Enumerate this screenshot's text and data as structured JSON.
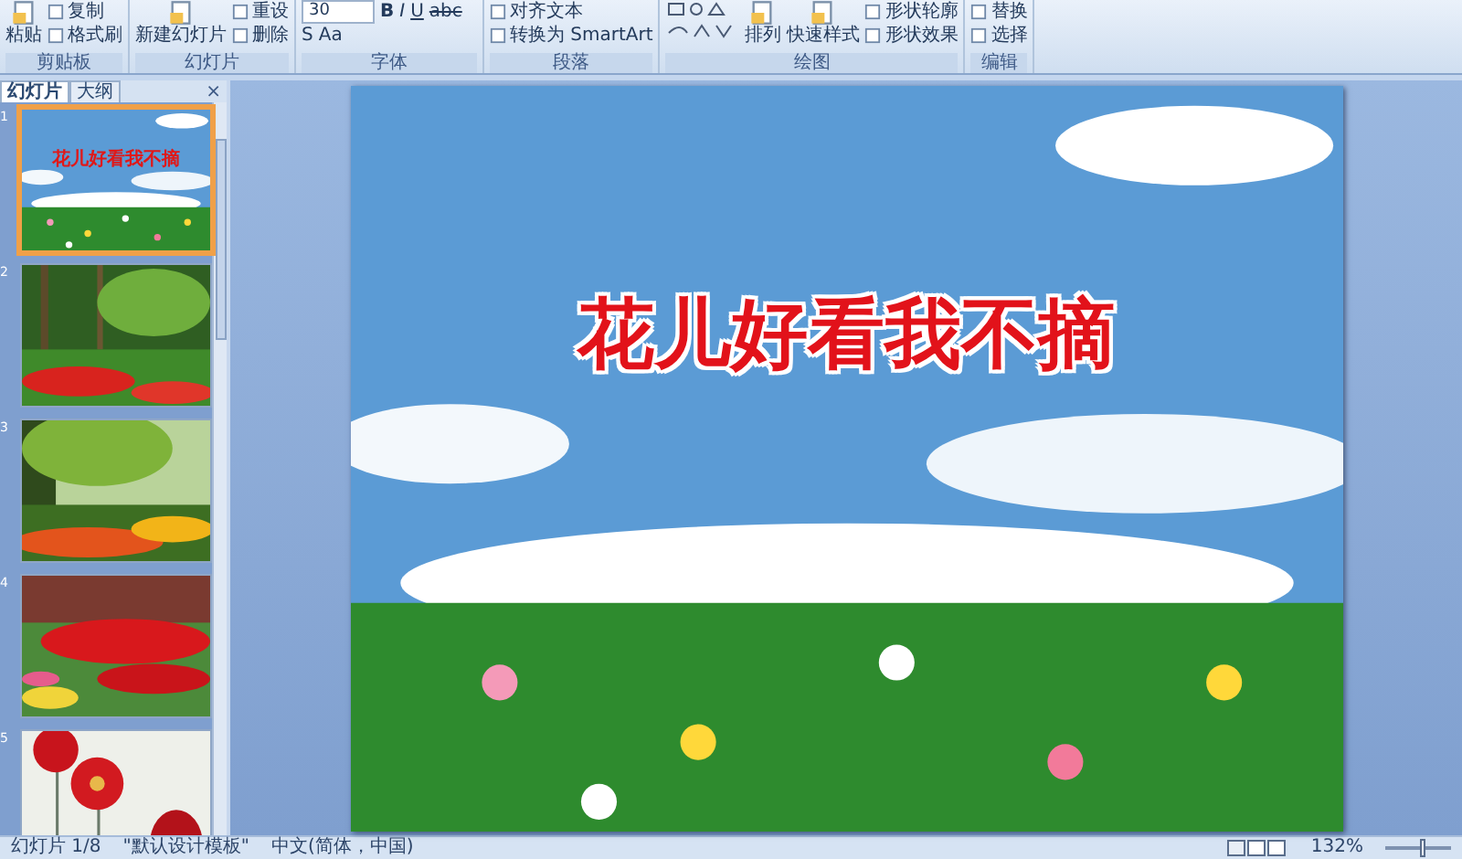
{
  "ribbon": {
    "groups": [
      {
        "label": "剪贴板",
        "items": [
          {
            "kind": "big",
            "label": "粘贴"
          },
          {
            "kind": "small",
            "label": "复制"
          },
          {
            "kind": "small",
            "label": "格式刷"
          }
        ]
      },
      {
        "label": "幻灯片",
        "items": [
          {
            "kind": "big",
            "label": "新建幻灯片"
          },
          {
            "kind": "small",
            "label": "重设"
          },
          {
            "kind": "small",
            "label": "删除"
          }
        ]
      },
      {
        "label": "字体",
        "items": [
          {
            "kind": "field",
            "label": "30"
          },
          {
            "kind": "bold",
            "label": "B"
          },
          {
            "kind": "italic",
            "label": "I"
          },
          {
            "kind": "underline",
            "label": "U"
          },
          {
            "kind": "strike",
            "label": "abc"
          },
          {
            "kind": "plain",
            "label": "S"
          },
          {
            "kind": "plain",
            "label": "Aa"
          }
        ]
      },
      {
        "label": "段落",
        "items": [
          {
            "kind": "small",
            "label": "对齐文本"
          },
          {
            "kind": "small",
            "label": "转换为 SmartArt"
          }
        ]
      },
      {
        "label": "绘图",
        "items": [
          {
            "kind": "shapes"
          },
          {
            "kind": "big",
            "label": "排列"
          },
          {
            "kind": "big",
            "label": "快速样式"
          },
          {
            "kind": "small",
            "label": "形状轮廓"
          },
          {
            "kind": "small",
            "label": "形状效果"
          }
        ]
      },
      {
        "label": "编辑",
        "items": [
          {
            "kind": "small",
            "label": "替换"
          },
          {
            "kind": "small",
            "label": "选择"
          }
        ]
      }
    ]
  },
  "panel": {
    "tabs": [
      {
        "label": "幻灯片",
        "selected": true
      },
      {
        "label": "大纲",
        "selected": false
      }
    ],
    "close": "×"
  },
  "slides": [
    {
      "number": "1",
      "selected": true,
      "title": "花儿好看我不摘"
    },
    {
      "number": "2",
      "selected": false
    },
    {
      "number": "3",
      "selected": false
    },
    {
      "number": "4",
      "selected": false
    },
    {
      "number": "5",
      "selected": false
    }
  ],
  "slide": {
    "title": "花儿好看我不摘"
  },
  "status_bar": {
    "texts": [
      "幻灯片 1/8",
      "\"默认设计模板\"",
      "中文(简体，中国)"
    ],
    "zoom": "132%",
    "zoom_level": {
      "level": 0.55
    }
  }
}
